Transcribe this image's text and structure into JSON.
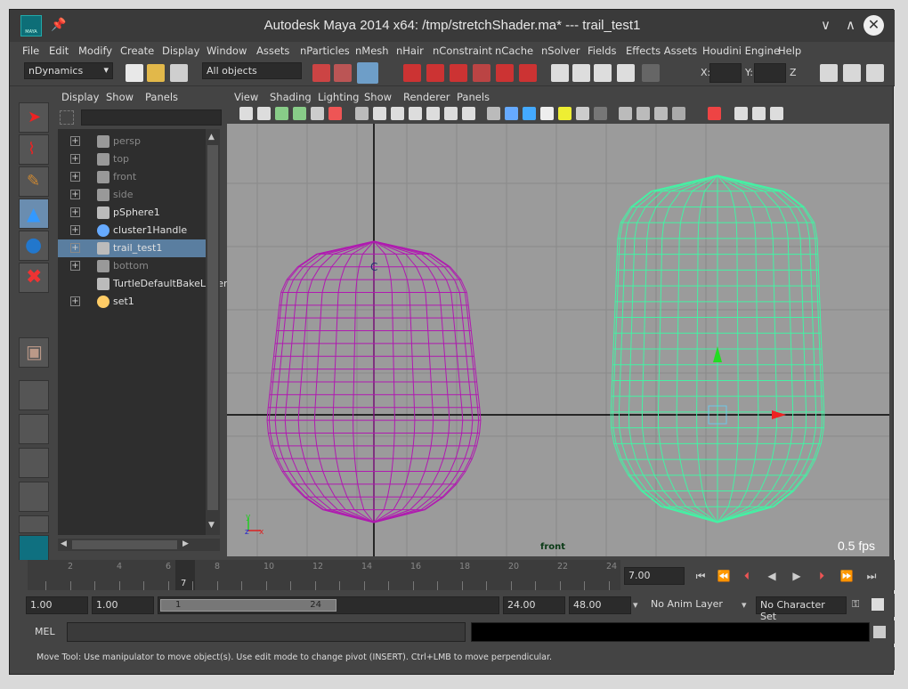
{
  "window": {
    "title": "Autodesk Maya 2014 x64: /tmp/stretchShader.ma*   ---   trail_test1",
    "icon_text": "MAYA"
  },
  "menubar": [
    "File",
    "Edit",
    "Modify",
    "Create",
    "Display",
    "Window",
    "Assets",
    "nParticles",
    "nMesh",
    "nHair",
    "nConstraint",
    "nCache",
    "nSolver",
    "Fields",
    "Effects Assets",
    "Houdini Engine",
    "Help"
  ],
  "shelf": {
    "menu_set": "nDynamics",
    "selection_mask": "All objects",
    "x_label": "X:",
    "y_label": "Y:",
    "z_label": "Z"
  },
  "outliner": {
    "menus": [
      "Display",
      "Show",
      "Panels"
    ],
    "items": [
      {
        "label": "persp",
        "dim": true,
        "icon": "camera-icon"
      },
      {
        "label": "top",
        "dim": true,
        "icon": "camera-icon"
      },
      {
        "label": "front",
        "dim": true,
        "icon": "camera-icon"
      },
      {
        "label": "side",
        "dim": true,
        "icon": "camera-icon"
      },
      {
        "label": "pSphere1",
        "dim": false,
        "icon": "mesh-icon"
      },
      {
        "label": "cluster1Handle",
        "dim": false,
        "icon": "cluster-icon"
      },
      {
        "label": "trail_test1",
        "dim": false,
        "icon": "mesh-icon",
        "selected": true
      },
      {
        "label": "bottom",
        "dim": true,
        "icon": "camera-icon"
      },
      {
        "label": "TurtleDefaultBakeLayer",
        "dim": false,
        "icon": "layer-icon"
      },
      {
        "label": "set1",
        "dim": false,
        "icon": "set-icon"
      }
    ]
  },
  "viewport": {
    "menus": [
      "View",
      "Shading",
      "Lighting",
      "Show",
      "Renderer",
      "Panels"
    ],
    "camera": "front",
    "fps": "0.5 fps",
    "cluster_marker": "C",
    "axis_y": "y",
    "axis_z": "z",
    "axis_x": "x"
  },
  "timeline": {
    "ticks": [
      "2",
      "4",
      "6",
      "8",
      "10",
      "12",
      "14",
      "16",
      "18",
      "20",
      "22",
      "24"
    ],
    "current_frame": "7",
    "current_frame_field": "7.00"
  },
  "range": {
    "start": "1.00",
    "start_inner": "1.00",
    "slider_start": "1",
    "slider_end": "24",
    "end_inner": "24.00",
    "end": "48.00",
    "anim_layer": "No Anim Layer",
    "character_set": "No Character Set"
  },
  "mel": {
    "label": "MEL"
  },
  "helpline": "Move Tool: Use manipulator to move object(s). Use edit mode to change pivot (INSERT).  Ctrl+LMB to move perpendicular.",
  "colors": {
    "left_wire": "#b01ab0",
    "right_wire": "#43f3a4",
    "viewport_bg": "#9b9b9b",
    "selection": "#5a7ea0"
  }
}
